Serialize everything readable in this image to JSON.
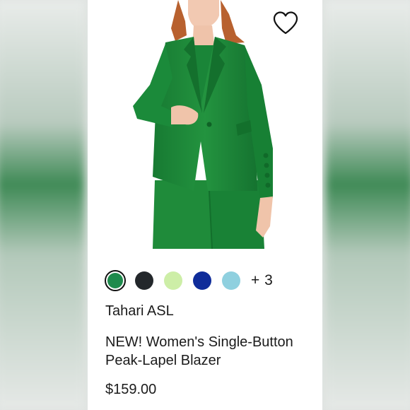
{
  "product": {
    "image_alt": "Woman wearing a green single-button peak-lapel blazer with matching green wide-leg pants",
    "brand": "Tahari ASL",
    "title": "NEW! Women's Single-Button Peak-Lapel Blazer",
    "price": "$159.00",
    "wishlist_icon": "heart-outline-icon"
  },
  "swatches": {
    "colors": [
      "#1e8a4c",
      "#23272b",
      "#cdeea7",
      "#0f2c9a",
      "#8fd0df"
    ],
    "selected_index": 0,
    "more_label": "+ 3"
  },
  "theme": {
    "accent_green": "#1e8a3c",
    "text": "#1b1b1b"
  }
}
